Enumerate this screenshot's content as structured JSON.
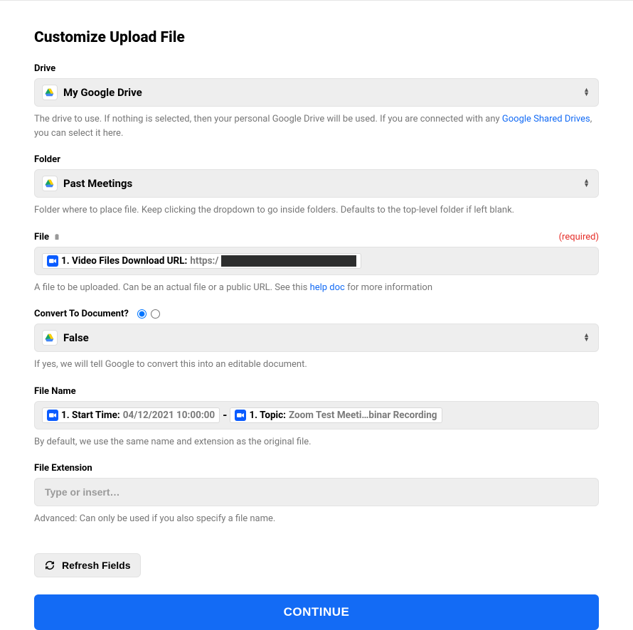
{
  "title": "Customize Upload File",
  "fields": {
    "drive": {
      "label": "Drive",
      "value": "My Google Drive",
      "help_pre": "The drive to use. If nothing is selected, then your personal Google Drive will be used. If you are connected with any ",
      "help_link": "Google Shared Drives",
      "help_post": ", you can select it here."
    },
    "folder": {
      "label": "Folder",
      "value": "Past Meetings",
      "help": "Folder where to place file. Keep clicking the dropdown to go inside folders. Defaults to the top-level folder if left blank."
    },
    "file": {
      "label": "File",
      "required": "(required)",
      "pill_label": "1. Video Files Download URL:",
      "pill_value_prefix": "https:/",
      "help_pre": "A file to be uploaded. Can be an actual file or a public URL. See this ",
      "help_link": "help doc",
      "help_post": " for more information"
    },
    "convert": {
      "label": "Convert To Document?",
      "value": "False",
      "help": "If yes, we will tell Google to convert this into an editable document."
    },
    "filename": {
      "label": "File Name",
      "pill1_label": "1. Start Time:",
      "pill1_value": "04/12/2021 10:00:00",
      "separator": "-",
      "pill2_label": "1. Topic:",
      "pill2_value": "Zoom Test Meeti…binar Recording",
      "help": "By default, we use the same name and extension as the original file."
    },
    "ext": {
      "label": "File Extension",
      "placeholder": "Type or insert…",
      "help": "Advanced: Can only be used if you also specify a file name."
    }
  },
  "buttons": {
    "refresh": "Refresh Fields",
    "continue": "CONTINUE"
  }
}
